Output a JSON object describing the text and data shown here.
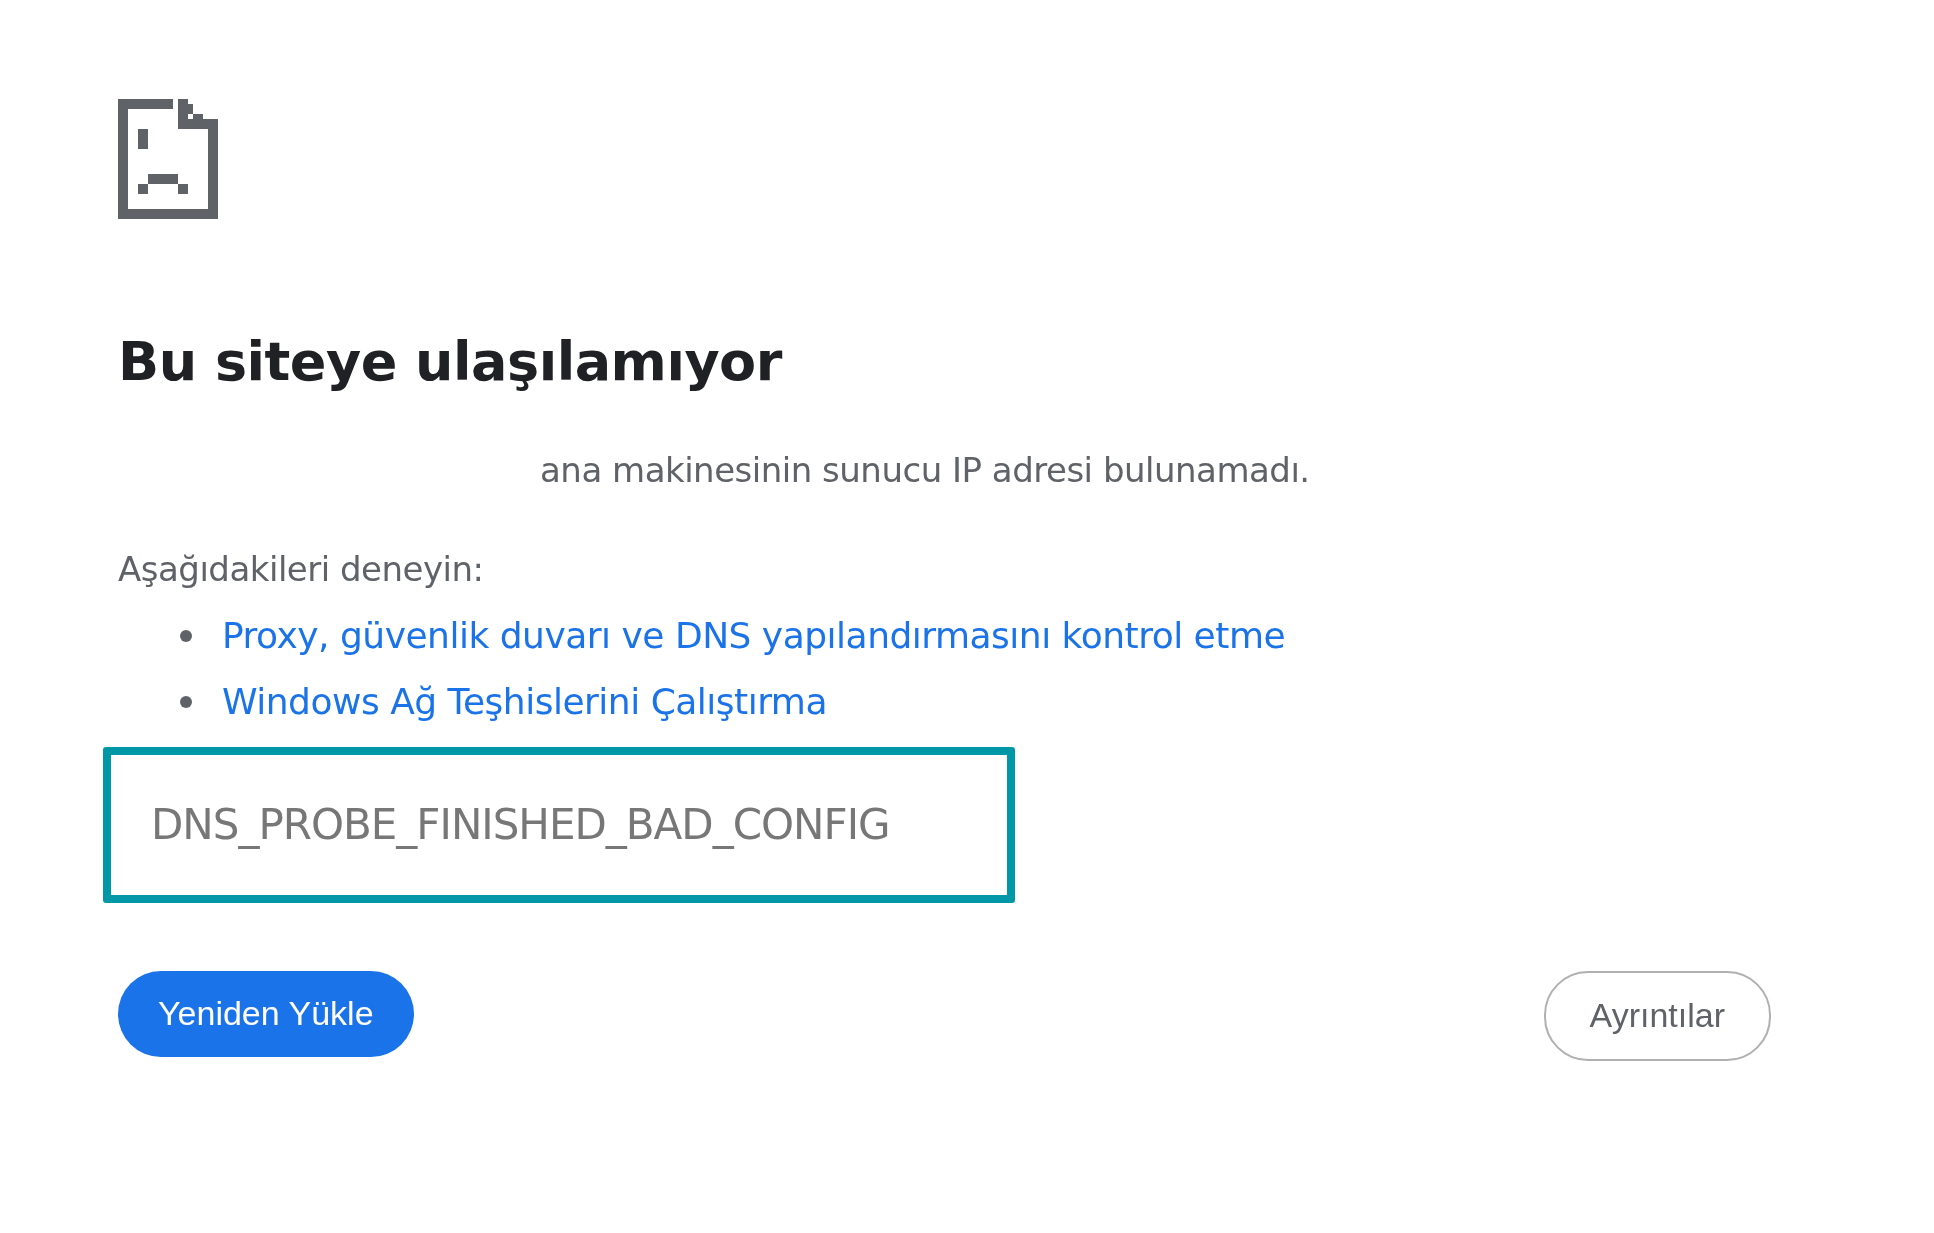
{
  "heading": "Bu siteye ulaşılamıyor",
  "message": "ana makinesinin sunucu IP adresi bulunamadı.",
  "suggestions_label": "Aşağıdakileri deneyin:",
  "suggestions": [
    {
      "text": "Proxy, güvenlik duvarı ve DNS yapılandırmasını kontrol etme"
    },
    {
      "text": "Windows Ağ Teşhislerini Çalıştırma"
    }
  ],
  "error_code": "DNS_PROBE_FINISHED_BAD_CONFIG",
  "buttons": [
    {
      "label": "Yeniden Yükle",
      "kind": "primary"
    },
    {
      "label": "Ayrıntılar",
      "kind": "secondary"
    }
  ]
}
